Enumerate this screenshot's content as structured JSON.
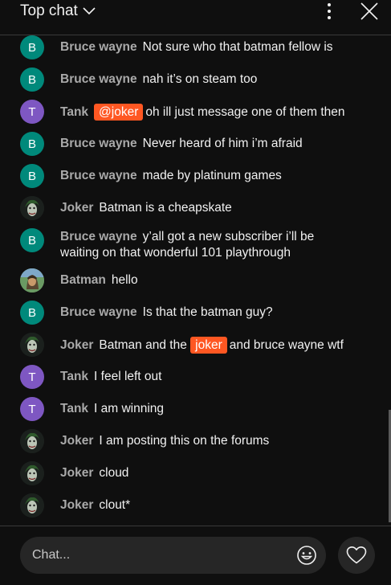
{
  "header": {
    "title": "Top chat",
    "dropdown_icon": "chevron-down-icon",
    "menu_icon": "more-vertical-icon",
    "close_icon": "close-icon"
  },
  "messages": [
    {
      "author": "Bruce wayne",
      "avatar_letter": "B",
      "text": "Not sure who that batman fellow is"
    },
    {
      "author": "Bruce wayne",
      "avatar_letter": "B",
      "text": "nah it’s on steam too"
    },
    {
      "author": "Tank",
      "avatar_letter": "T",
      "mention": "@joker",
      "text": "oh ill just message one of them then"
    },
    {
      "author": "Bruce wayne",
      "avatar_letter": "B",
      "text": "Never heard of him i’m afraid"
    },
    {
      "author": "Bruce wayne",
      "avatar_letter": "B",
      "text": "made by platinum games"
    },
    {
      "author": "Joker",
      "avatar_letter": "",
      "text": "Batman is a cheapskate"
    },
    {
      "author": "Bruce wayne",
      "avatar_letter": "B",
      "text": "y’all got a new subscriber i’ll be waiting on that wonderful 101 playthrough"
    },
    {
      "author": "Batman",
      "avatar_letter": "",
      "text": "hello"
    },
    {
      "author": "Bruce wayne",
      "avatar_letter": "B",
      "text": "Is that the batman guy?"
    },
    {
      "author": "Joker",
      "avatar_letter": "",
      "text_before": "Batman and the",
      "mention": "joker",
      "text": "and bruce wayne wtf"
    },
    {
      "author": "Tank",
      "avatar_letter": "T",
      "text": "I feel left out"
    },
    {
      "author": "Tank",
      "avatar_letter": "T",
      "text": "I am winning"
    },
    {
      "author": "Joker",
      "avatar_letter": "",
      "text": "I am posting this on the forums"
    },
    {
      "author": "Joker",
      "avatar_letter": "",
      "text": "cloud"
    },
    {
      "author": "Joker",
      "avatar_letter": "",
      "text": "clout*"
    }
  ],
  "input": {
    "placeholder": "Chat...",
    "emoji_icon": "emoji-smile-icon",
    "like_icon": "heart-icon"
  },
  "colors": {
    "background": "#0f0f0f",
    "mention_highlight": "#ff5722",
    "avatar_bruce": "#00897b",
    "avatar_tank": "#7e57c2",
    "author_text": "#aaaaaa"
  }
}
